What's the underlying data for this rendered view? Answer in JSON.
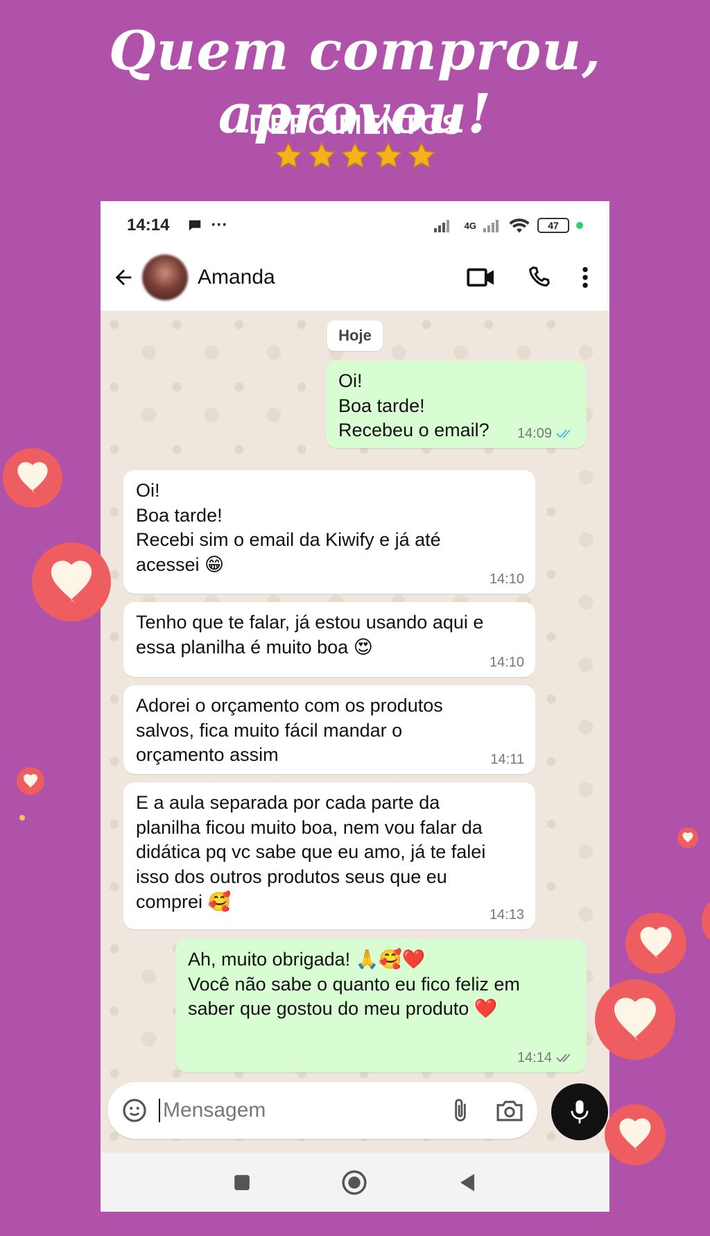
{
  "banner": {
    "headline": "Quem comprou, aprovou!",
    "subhead": "DEPOIMENTOS",
    "stars": 5
  },
  "statusbar": {
    "time": "14:14",
    "network": "4G",
    "battery": "47"
  },
  "header": {
    "contact_name": "Amanda",
    "icons": [
      "back-arrow-icon",
      "video-call-icon",
      "phone-icon",
      "more-vert-icon"
    ]
  },
  "chat": {
    "date_chip": "Hoje",
    "messages": [
      {
        "dir": "out",
        "lines": [
          "Oi!",
          "Boa tarde!",
          "Recebeu o email?"
        ],
        "time": "14:09",
        "ticks": "read"
      },
      {
        "dir": "in",
        "lines": [
          "Oi!",
          "Boa tarde!",
          "Recebi sim o email da Kiwify e já até",
          "acessei 😁"
        ],
        "time": "14:10"
      },
      {
        "dir": "in",
        "lines": [
          "Tenho que te falar, já estou usando aqui e",
          "essa planilha é muito boa 😍"
        ],
        "time": "14:10"
      },
      {
        "dir": "in",
        "lines": [
          "Adorei o orçamento com os produtos",
          "salvos, fica muito fácil mandar o",
          "orçamento assim"
        ],
        "time": "14:11"
      },
      {
        "dir": "in",
        "lines": [
          "E a aula separada por cada parte da",
          "planilha ficou muito boa, nem vou falar da",
          "didática pq vc sabe que eu amo, já te falei",
          "isso dos outros produtos seus que eu",
          "comprei 🥰"
        ],
        "time": "14:13"
      },
      {
        "dir": "out",
        "lines": [
          "Ah, muito obrigada! 🙏🥰❤️",
          "Você não sabe o quanto eu fico feliz em",
          "saber que gostou do meu produto ❤️"
        ],
        "time": "14:14",
        "ticks": "delivered"
      }
    ]
  },
  "input": {
    "placeholder": "Mensagem",
    "icons": [
      "sticker-icon",
      "attach-icon",
      "camera-icon",
      "mic-icon"
    ]
  },
  "colors": {
    "background": "#b052aa",
    "outgoing_bubble": "#d9fdd3",
    "incoming_bubble": "#ffffff",
    "heart": "#ee5d5f",
    "star": "#f6b21a",
    "read_ticks": "#53bdeb"
  }
}
